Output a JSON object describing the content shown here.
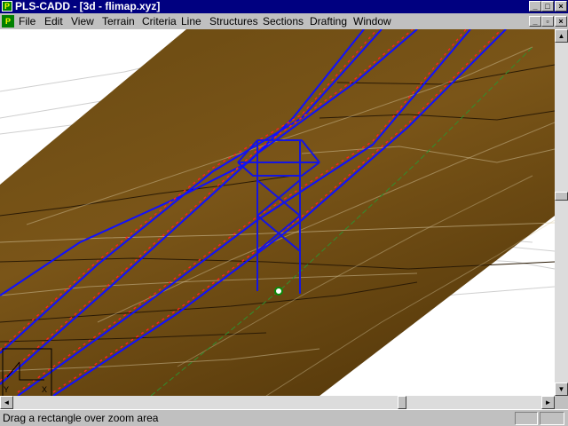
{
  "window": {
    "title": "PLS-CADD - [3d - flimap.xyz]",
    "app_icon": "app-logo-icon",
    "controls": {
      "minimize": "_",
      "maximize": "□",
      "close": "×"
    }
  },
  "document_controls": {
    "minimize": "_",
    "restore": "▫",
    "close": "×"
  },
  "menu": {
    "items": [
      "File",
      "Edit",
      "View",
      "Terrain",
      "Criteria",
      "Line",
      "Structures",
      "Sections",
      "Drafting",
      "Window"
    ]
  },
  "viewport": {
    "axis_labels": {
      "y": "Y",
      "x": "X"
    },
    "colors": {
      "terrain": "#6b4a10",
      "conductor": "#1010ff",
      "insulator_marks": "#ff2020",
      "tower": "#1515e0",
      "centerline": "#2f8f2f",
      "contours": "#cfcfcf"
    }
  },
  "scrollbars": {
    "up_arrow": "▲",
    "down_arrow": "▼",
    "left_arrow": "◄",
    "right_arrow": "►",
    "vertical_position": 0.45,
    "horizontal_position": 0.74
  },
  "status": {
    "message": "Drag a rectangle over zoom area"
  }
}
